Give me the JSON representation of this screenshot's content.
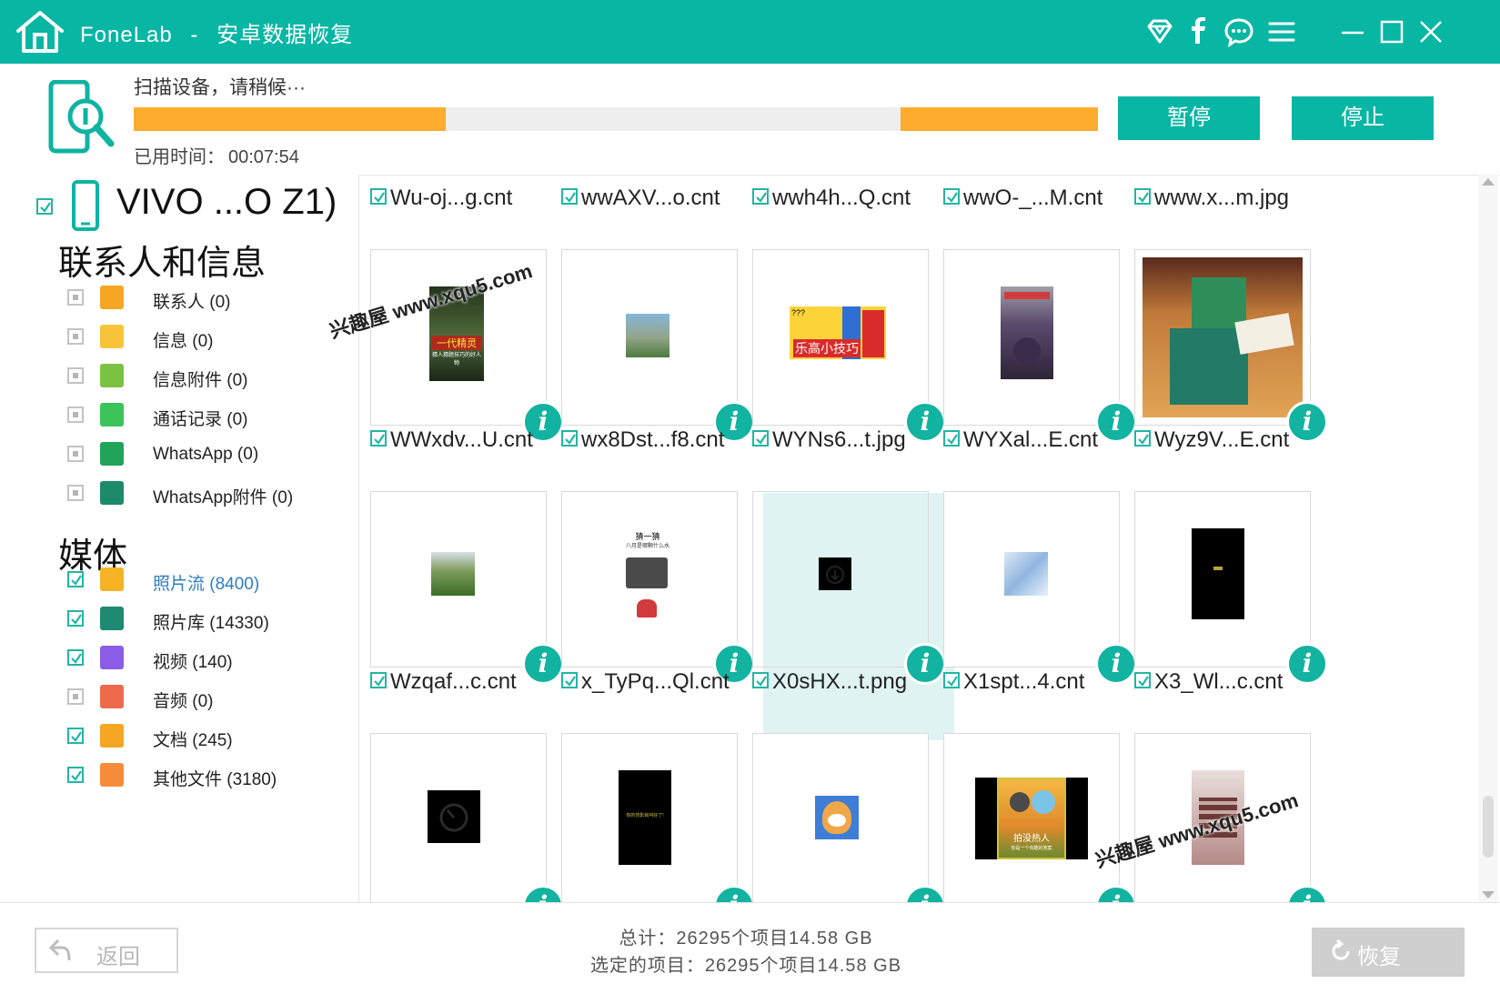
{
  "app": {
    "name": "FoneLab",
    "separator": "-",
    "title": "安卓数据恢复"
  },
  "window_icons": [
    "diamond-icon",
    "facebook-icon",
    "chat-icon",
    "menu-icon",
    "minimize-icon",
    "maximize-icon",
    "close-icon"
  ],
  "scan": {
    "status": "扫描设备，请稍候···",
    "elapsed_label": "已用时间：",
    "elapsed_value": "00:07:54",
    "progress_segments": [
      0.324,
      0.795
    ],
    "pause_label": "暂停",
    "stop_label": "停止"
  },
  "device": {
    "name": "VIVO ...O Z1)",
    "checked": true
  },
  "sections": [
    {
      "title": "联系人和信息",
      "items": [
        {
          "label": "联系人 (0)",
          "checked": false,
          "icon": "contacts-icon",
          "color": "#f5a623"
        },
        {
          "label": "信息 (0)",
          "checked": false,
          "icon": "messages-icon",
          "color": "#f8c53a"
        },
        {
          "label": "信息附件 (0)",
          "checked": false,
          "icon": "attachment-icon",
          "color": "#7cc242"
        },
        {
          "label": "通话记录 (0)",
          "checked": false,
          "icon": "call-log-icon",
          "color": "#3cc35a"
        },
        {
          "label": "WhatsApp (0)",
          "checked": false,
          "icon": "whatsapp-icon",
          "color": "#21a35a"
        },
        {
          "label": "WhatsApp附件 (0)",
          "checked": false,
          "icon": "whatsapp-attachment-icon",
          "color": "#1d8a6a"
        }
      ]
    },
    {
      "title": "媒体",
      "items": [
        {
          "label": "照片流 (8400)",
          "checked": true,
          "icon": "photo-stream-icon",
          "color": "#f5b325",
          "active": true
        },
        {
          "label": "照片库 (14330)",
          "checked": true,
          "icon": "photo-library-icon",
          "color": "#1e8a72"
        },
        {
          "label": "视频 (140)",
          "checked": true,
          "icon": "video-icon",
          "color": "#8b5ce6"
        },
        {
          "label": "音频 (0)",
          "checked": false,
          "icon": "audio-icon",
          "color": "#ef6a4a"
        },
        {
          "label": "文档 (245)",
          "checked": true,
          "icon": "documents-icon",
          "color": "#f5a623"
        },
        {
          "label": "其他文件 (3180)",
          "checked": true,
          "icon": "other-files-icon",
          "color": "#f58d3a"
        }
      ]
    }
  ],
  "files": {
    "row0": [
      "Wu-oj...g.cnt",
      "wwAXV...o.cnt",
      "wwh4h...Q.cnt",
      "wwO-_...M.cnt",
      "www.x...m.jpg"
    ],
    "row1": [
      "WWxdv...U.cnt",
      "wx8Dst...f8.cnt",
      "WYNs6...t.jpg",
      "WYXal...E.cnt",
      "Wyz9V...E.cnt"
    ],
    "row2": [
      "Wzqaf...c.cnt",
      "x_TyPq...Ql.cnt",
      "X0sHX...t.png",
      "X1spt...4.cnt",
      "X3_Wl...c.cnt"
    ]
  },
  "thumb_text": {
    "row1_c0": "一代精灵",
    "row1_c0_sub": "猜人猜题技巧的好人物",
    "row1_c2": "乐高小技巧",
    "row1_c2_tag": "???",
    "row2_c1_title": "猜一猜",
    "row2_c1_sub": "八月是哪颗什么水",
    "row3_c1": "你的背影就叫好了!",
    "row3_c3": "拍没热人",
    "row3_c3_sub": "你是一个有趣的答案"
  },
  "watermark": "兴趣屋 www.xqu5.com",
  "footer": {
    "back_label": "返回",
    "total": "总计：26295个项目14.58 GB",
    "selected": "选定的项目：26295个项目14.58 GB",
    "recover_label": "恢复"
  },
  "colors": {
    "brand": "#08b6a4",
    "progress": "#fdac2d",
    "highlight": "#dff4f2"
  }
}
